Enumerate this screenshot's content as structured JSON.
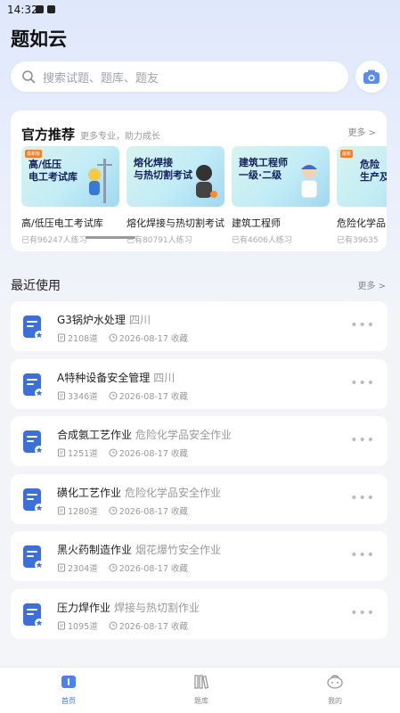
{
  "status": {
    "time": "14:32"
  },
  "app": {
    "title": "题如云"
  },
  "search": {
    "placeholder": "搜索试题、题库、题友"
  },
  "recommend": {
    "title": "官方推荐",
    "subtitle": "更多专业，助力成长",
    "more": "更多 >",
    "items": [
      {
        "name": "高/低压电工考试库",
        "count": "已有96247人练习",
        "img_title": "高/低压\n电工考试库",
        "tag": "最新版"
      },
      {
        "name": "熔化焊接与热切割考试",
        "count": "已有80791人练习",
        "img_title": "熔化焊接\n与热切割考试",
        "tag": ""
      },
      {
        "name": "建筑工程师",
        "count": "已有4606人练习",
        "img_title": "建筑工程师\n一级·二级",
        "tag": ""
      },
      {
        "name": "危险化学品",
        "count": "已有39635",
        "img_title": "危险\n生产及",
        "tag": "最新"
      }
    ]
  },
  "recent": {
    "title": "最近使用",
    "more": "更多 >",
    "items": [
      {
        "title": "G3锅炉水处理",
        "category": "四川",
        "count": "2108道",
        "date": "2026-08-17 收藏"
      },
      {
        "title": "A特种设备安全管理",
        "category": "四川",
        "count": "3346道",
        "date": "2026-08-17 收藏"
      },
      {
        "title": "合成氨工艺作业",
        "category": "危险化学品安全作业",
        "count": "1251道",
        "date": "2026-08-17 收藏"
      },
      {
        "title": "磺化工艺作业",
        "category": "危险化学品安全作业",
        "count": "1280道",
        "date": "2026-08-17 收藏"
      },
      {
        "title": "黑火药制造作业",
        "category": "烟花爆竹安全作业",
        "count": "2304道",
        "date": "2026-08-17 收藏"
      },
      {
        "title": "压力焊作业",
        "category": "焊接与热切割作业",
        "count": "1095道",
        "date": "2026-08-17 收藏"
      }
    ]
  },
  "tabs": [
    {
      "label": "首页",
      "icon": "home-icon",
      "active": true
    },
    {
      "label": "题库",
      "icon": "library-icon",
      "active": false
    },
    {
      "label": "我的",
      "icon": "profile-icon",
      "active": false
    }
  ],
  "colors": {
    "accent": "#3a75e8",
    "icon_blue": "#3d6fd8"
  }
}
